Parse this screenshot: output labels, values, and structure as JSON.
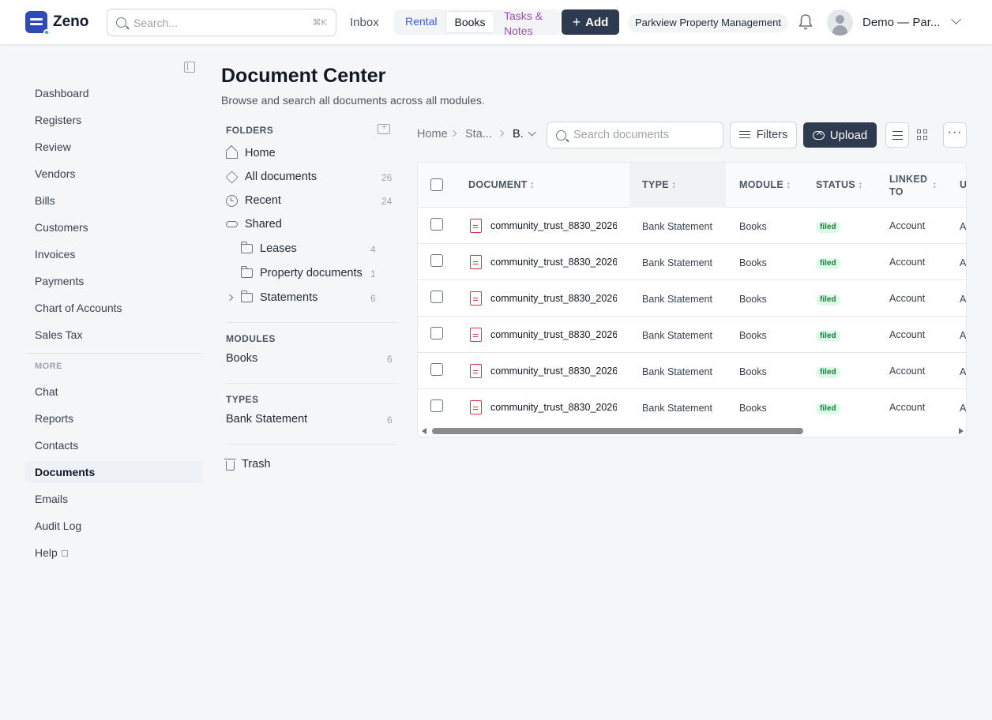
{
  "app": {
    "name": "Zeno"
  },
  "topbar": {
    "search_placeholder": "Search...",
    "search_shortcut": "⌘K",
    "inbox": "Inbox",
    "modes": [
      "Rental",
      "Books",
      "Tasks & Notes"
    ],
    "active_mode": "Books",
    "add_label": "Add",
    "organization": "Parkview Property Management",
    "user": "Demo — Par..."
  },
  "sidebar": {
    "items": [
      "Dashboard",
      "Registers",
      "Review",
      "Vendors",
      "Bills",
      "Customers",
      "Invoices",
      "Payments",
      "Chart of Accounts",
      "Sales Tax"
    ],
    "more_label": "MORE",
    "more_items": [
      "Chat",
      "Reports",
      "Contacts",
      "Documents",
      "Emails",
      "Audit Log",
      "Help"
    ],
    "active": "Documents"
  },
  "page": {
    "title": "Document Center",
    "subtitle": "Browse and search all documents across all modules."
  },
  "folders": {
    "label": "FOLDERS",
    "items": [
      {
        "name": "Home",
        "icon": "home-icon",
        "count": ""
      },
      {
        "name": "All documents",
        "icon": "layers-icon",
        "count": "26"
      },
      {
        "name": "Recent",
        "icon": "clock-icon",
        "count": "24"
      },
      {
        "name": "Shared",
        "icon": "link-icon",
        "count": ""
      },
      {
        "name": "Leases",
        "icon": "folder-icon",
        "count": "4"
      },
      {
        "name": "Property documents",
        "icon": "folder-icon",
        "count": "1"
      },
      {
        "name": "Statements",
        "icon": "folder-icon",
        "count": "6"
      }
    ]
  },
  "modules": {
    "label": "MODULES",
    "items": [
      {
        "name": "Books",
        "count": "6"
      }
    ]
  },
  "types": {
    "label": "TYPES",
    "items": [
      {
        "name": "Bank Statement",
        "count": "6"
      }
    ]
  },
  "trash": "Trash",
  "toolbar": {
    "breadcrumb": [
      "Home",
      "Sta...",
      "B."
    ],
    "search_placeholder": "Search documents",
    "filters_label": "Filters",
    "upload_label": "Upload",
    "more": "···"
  },
  "table": {
    "columns": [
      "DOCUMENT",
      "TYPE",
      "MODULE",
      "STATUS",
      "LINKED TO",
      "U"
    ],
    "rows": [
      {
        "document": "community_trust_8830_2026",
        "type": "Bank Statement",
        "module": "Books",
        "status": "filed",
        "linked": "Account",
        "extra": "A"
      },
      {
        "document": "community_trust_8830_2026",
        "type": "Bank Statement",
        "module": "Books",
        "status": "filed",
        "linked": "Account",
        "extra": "A"
      },
      {
        "document": "community_trust_8830_2026",
        "type": "Bank Statement",
        "module": "Books",
        "status": "filed",
        "linked": "Account",
        "extra": "A"
      },
      {
        "document": "community_trust_8830_2026",
        "type": "Bank Statement",
        "module": "Books",
        "status": "filed",
        "linked": "Account",
        "extra": "A"
      },
      {
        "document": "community_trust_8830_2026",
        "type": "Bank Statement",
        "module": "Books",
        "status": "filed",
        "linked": "Account",
        "extra": "A"
      },
      {
        "document": "community_trust_8830_2026",
        "type": "Bank Statement",
        "module": "Books",
        "status": "filed",
        "linked": "Account",
        "extra": "A"
      }
    ]
  },
  "colors": {
    "accent": "#2d3a4f",
    "brand": "#2f4bb8",
    "status_filed": "#15803d"
  }
}
